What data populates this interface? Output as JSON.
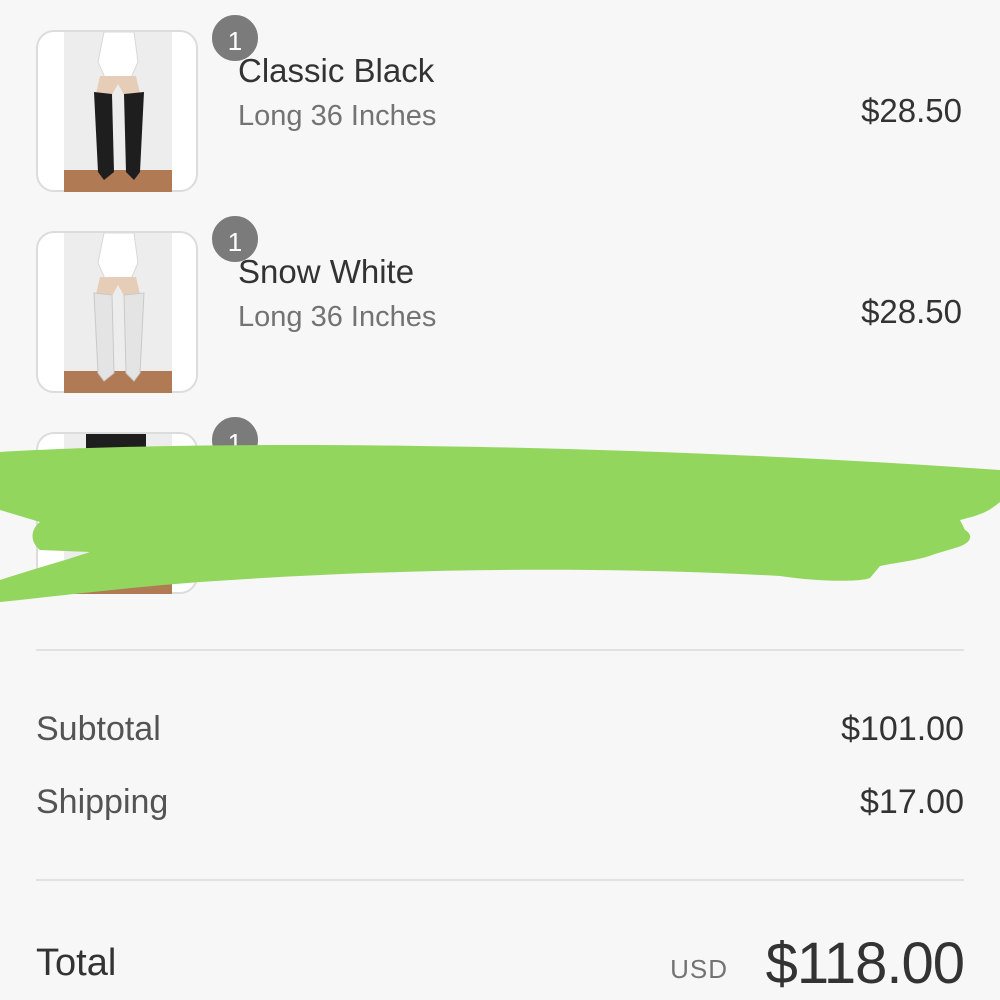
{
  "order_summary": {
    "line_items": [
      {
        "quantity": "1",
        "name": "Classic Black",
        "variant": "Long 36 Inches",
        "price": "$28.50",
        "product_color": "#1e1e1e"
      },
      {
        "quantity": "1",
        "name": "Snow White",
        "variant": "Long 36 Inches",
        "price": "$28.50",
        "product_color": "#e8e8e8"
      },
      {
        "quantity": "1",
        "product_color": "#1e1e1e"
      }
    ],
    "subtotal_label": "Subtotal",
    "subtotal_value": "$101.00",
    "shipping_label": "Shipping",
    "shipping_value": "$17.00",
    "total_label": "Total",
    "total_currency": "USD",
    "total_value": "$118.00"
  },
  "colors": {
    "background": "#f7f7f7",
    "badge": "#7b7b7b",
    "redaction_scribble": "#93d65e",
    "text_primary": "#333333",
    "text_secondary": "#737373"
  }
}
